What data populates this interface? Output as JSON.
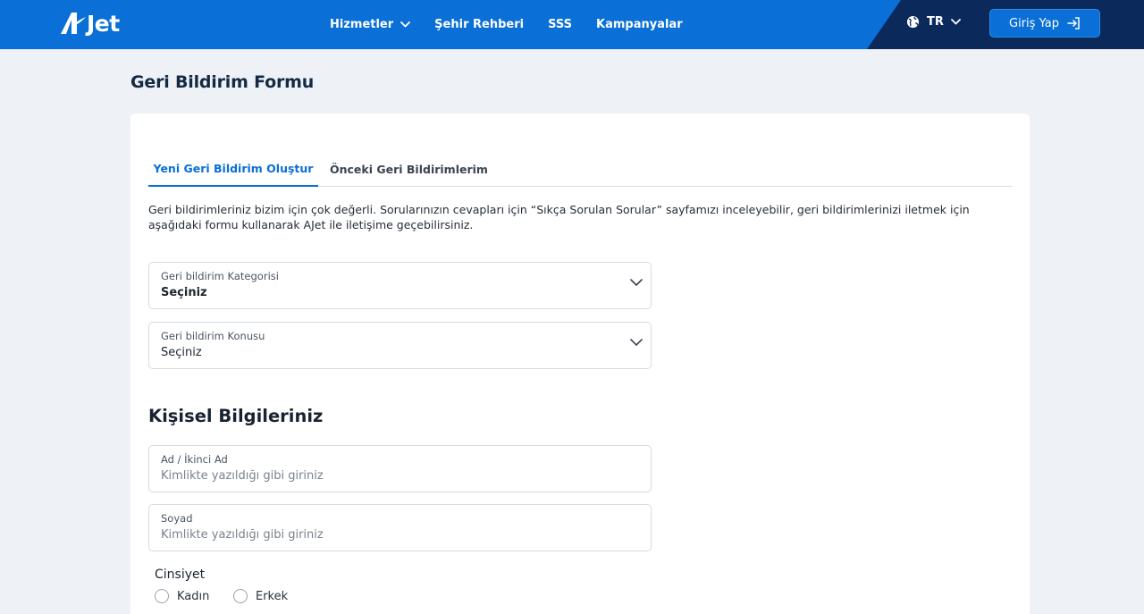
{
  "header": {
    "logo_text": "Jet",
    "nav": {
      "services": "Hizmetler",
      "city_guide": "Şehir Rehberi",
      "faq": "SSS",
      "campaigns": "Kampanyalar"
    },
    "language": "TR",
    "login_label": "Giriş Yap",
    "colors": {
      "primary": "#0a6fd6",
      "dark": "#0b2a5b"
    }
  },
  "page": {
    "title": "Geri Bildirim Formu"
  },
  "tabs": {
    "new": "Yeni Geri Bildirim Oluştur",
    "previous": "Önceki Geri Bildirimlerim"
  },
  "intro": "Geri bildirimleriniz bizim için çok değerli. Sorularınızın cevapları için “Sıkça Sorulan Sorular” sayfamızı inceleyebilir, geri bildirimlerinizi iletmek için aşağıdaki formu kullanarak AJet ile iletişime geçebilirsiniz.",
  "form": {
    "category": {
      "label": "Geri bildirim Kategorisi",
      "value": "Seçiniz"
    },
    "subject": {
      "label": "Geri bildirim Konusu",
      "value": "Seçiniz"
    }
  },
  "personal": {
    "title": "Kişisel Bilgileriniz",
    "first_name": {
      "label": "Ad / İkinci Ad",
      "placeholder": "Kimlikte yazıldığı gibi giriniz"
    },
    "last_name": {
      "label": "Soyad",
      "placeholder": "Kimlikte yazıldığı gibi giriniz"
    },
    "gender": {
      "label": "Cinsiyet",
      "options": [
        "Kadın",
        "Erkek"
      ]
    }
  }
}
